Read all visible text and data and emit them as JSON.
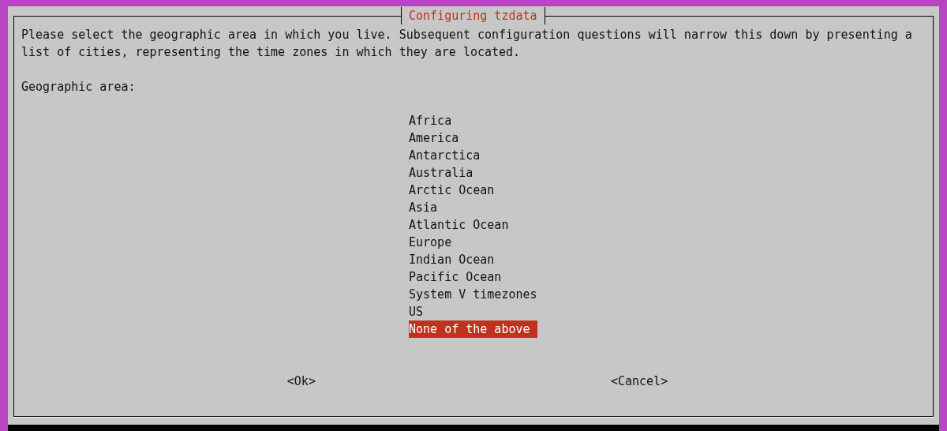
{
  "dialog": {
    "title": "Configuring tzdata",
    "message": "Please select the geographic area in which you live. Subsequent configuration questions will narrow this down by presenting a list of cities, representing the time zones in which they are located.",
    "prompt": "Geographic area:",
    "options": [
      {
        "label": "Africa",
        "selected": false
      },
      {
        "label": "America",
        "selected": false
      },
      {
        "label": "Antarctica",
        "selected": false
      },
      {
        "label": "Australia",
        "selected": false
      },
      {
        "label": "Arctic Ocean",
        "selected": false
      },
      {
        "label": "Asia",
        "selected": false
      },
      {
        "label": "Atlantic Ocean",
        "selected": false
      },
      {
        "label": "Europe",
        "selected": false
      },
      {
        "label": "Indian Ocean",
        "selected": false
      },
      {
        "label": "Pacific Ocean",
        "selected": false
      },
      {
        "label": "System V timezones",
        "selected": false
      },
      {
        "label": "US",
        "selected": false
      },
      {
        "label": "None of the above",
        "selected": true
      }
    ],
    "buttons": [
      {
        "label": "<Ok>",
        "selected": false
      },
      {
        "label": "<Cancel>",
        "selected": false
      }
    ]
  }
}
